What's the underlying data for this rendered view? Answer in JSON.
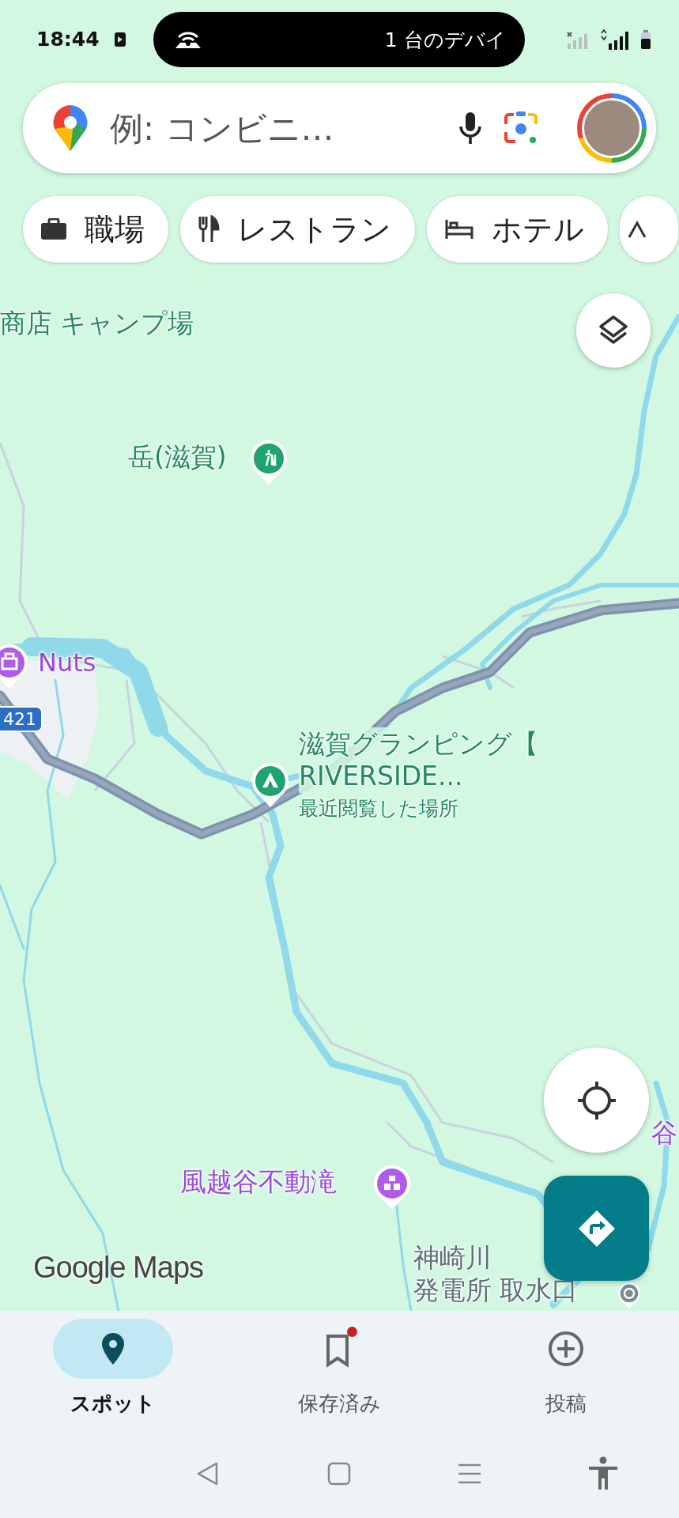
{
  "status_bar": {
    "time": "18:44",
    "notification": "1 台のデバイ"
  },
  "search": {
    "placeholder": "例: コンビニ…"
  },
  "chips": [
    {
      "kind": "work",
      "label": "職場"
    },
    {
      "kind": "restaurant",
      "label": "レストラン"
    },
    {
      "kind": "hotel",
      "label": "ホテル"
    },
    {
      "kind": "cut"
    }
  ],
  "map": {
    "labels": [
      {
        "kind": "park",
        "lines": [
          "商店 キャンプ場"
        ]
      },
      {
        "kind": "hiking",
        "lines": [
          "岳(滋賀)"
        ]
      },
      {
        "kind": "shop",
        "lines": [
          "Nuts"
        ]
      },
      {
        "kind": "camp",
        "lines": [
          "滋賀グランピング【",
          "RIVERSIDE..."
        ],
        "note": "最近閲覧した場所"
      },
      {
        "kind": "edge",
        "lines": [
          "谷"
        ]
      },
      {
        "kind": "attraction",
        "lines": [
          "風越谷不動滝"
        ]
      },
      {
        "kind": "facility",
        "lines": [
          "神崎川",
          "発電所 取水口"
        ]
      }
    ],
    "route_shield": "421",
    "logo": "Google Maps"
  },
  "bottom_nav": [
    {
      "kind": "explore",
      "label": "スポット",
      "selected": true,
      "has_update": false
    },
    {
      "kind": "saved",
      "label": "保存済み",
      "selected": false,
      "has_update": true
    },
    {
      "kind": "contribute",
      "label": "投稿",
      "selected": false,
      "has_update": false
    }
  ]
}
